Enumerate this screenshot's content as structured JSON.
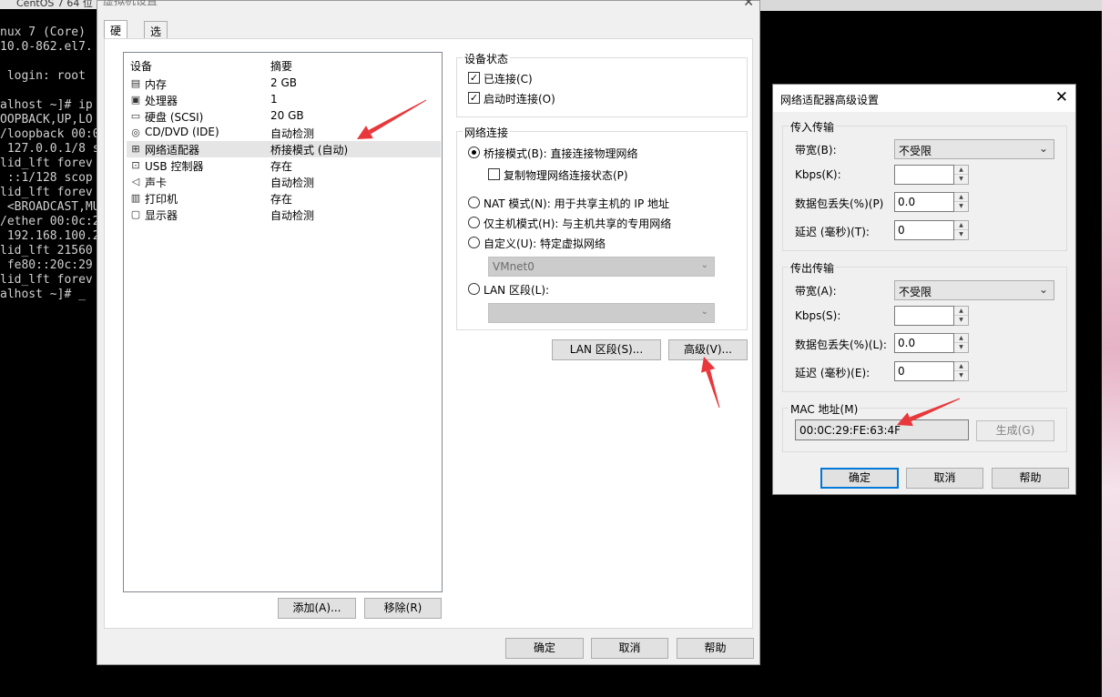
{
  "background": {
    "taskbar_tab": "CentOS 7 64 位",
    "terminal_lines": [
      "nux 7 (Core)",
      "10.0-862.el7.",
      "",
      " login: root",
      "",
      "alhost ~]# ip",
      "OOPBACK,UP,LO",
      "/loopback 00:0",
      " 127.0.0.1/8 s",
      "lid_lft forev",
      " ::1/128 scop",
      "lid_lft forev",
      " <BROADCAST,MU",
      "/ether 00:0c:2",
      " 192.168.100.2",
      "lid_lft 21560",
      " fe80::20c:29",
      "lid_lft forev",
      "alhost ~]# _"
    ]
  },
  "main_dialog": {
    "title": "虚拟机设置",
    "tabs": [
      "硬件",
      "选项"
    ],
    "device_list": {
      "header_device": "设备",
      "header_summary": "摘要",
      "rows": [
        {
          "icon": "memory-icon",
          "name": "内存",
          "summary": "2 GB"
        },
        {
          "icon": "processor-icon",
          "name": "处理器",
          "summary": "1"
        },
        {
          "icon": "hard-disk-icon",
          "name": "硬盘 (SCSI)",
          "summary": "20 GB"
        },
        {
          "icon": "cd-dvd-icon",
          "name": "CD/DVD (IDE)",
          "summary": "自动检测"
        },
        {
          "icon": "network-adapter-icon",
          "name": "网络适配器",
          "summary": "桥接模式 (自动)"
        },
        {
          "icon": "usb-icon",
          "name": "USB 控制器",
          "summary": "存在"
        },
        {
          "icon": "sound-card-icon",
          "name": "声卡",
          "summary": "自动检测"
        },
        {
          "icon": "printer-icon",
          "name": "打印机",
          "summary": "存在"
        },
        {
          "icon": "display-icon",
          "name": "显示器",
          "summary": "自动检测"
        }
      ]
    },
    "add_button": "添加(A)...",
    "remove_button": "移除(R)",
    "device_status": {
      "title": "设备状态",
      "connected": "已连接(C)",
      "connect_on_power": "启动时连接(O)"
    },
    "network_connection": {
      "title": "网络连接",
      "bridged": "桥接模式(B): 直接连接物理网络",
      "replicate": "复制物理网络连接状态(P)",
      "nat": "NAT 模式(N): 用于共享主机的 IP 地址",
      "host_only": "仅主机模式(H): 与主机共享的专用网络",
      "custom": "自定义(U): 特定虚拟网络",
      "vmnet_value": "VMnet0",
      "lan_segment": "LAN 区段(L):"
    },
    "lan_segments_button": "LAN 区段(S)...",
    "advanced_button": "高级(V)...",
    "ok_button": "确定",
    "cancel_button": "取消",
    "help_button": "帮助"
  },
  "advanced_dialog": {
    "title": "网络适配器高级设置",
    "incoming": {
      "title": "传入传输",
      "bandwidth_label": "带宽(B):",
      "bandwidth_value": "不受限",
      "kbps_label": "Kbps(K):",
      "kbps_value": "",
      "loss_label": "数据包丢失(%)(P)",
      "loss_value": "0.0",
      "latency_label": "延迟 (毫秒)(T):",
      "latency_value": "0"
    },
    "outgoing": {
      "title": "传出传输",
      "bandwidth_label": "带宽(A):",
      "bandwidth_value": "不受限",
      "kbps_label": "Kbps(S):",
      "kbps_value": "",
      "loss_label": "数据包丢失(%)(L):",
      "loss_value": "0.0",
      "latency_label": "延迟 (毫秒)(E):",
      "latency_value": "0"
    },
    "mac": {
      "title": "MAC 地址(M)",
      "value": "00:0C:29:FE:63:4F",
      "generate_button": "生成(G)"
    },
    "ok_button": "确定",
    "cancel_button": "取消",
    "help_button": "帮助"
  },
  "colors": {
    "annotation_arrow": "#e8383b",
    "focus_border": "#0078d7"
  }
}
